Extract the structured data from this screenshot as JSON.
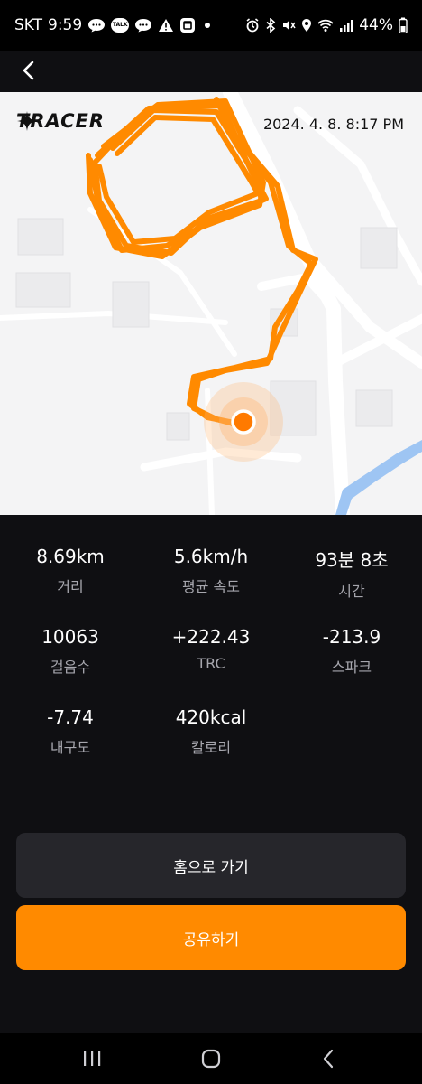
{
  "status_bar": {
    "carrier": "SKT",
    "time": "9:59",
    "talk_badge": "TALK",
    "battery": "44%"
  },
  "map": {
    "brand": "TRACER",
    "datetime": "2024. 4. 8. 8:17 PM",
    "route_color": "#FF8A00"
  },
  "stats": [
    {
      "value": "8.69km",
      "label": "거리"
    },
    {
      "value": "5.6km/h",
      "label": "평균 속도"
    },
    {
      "value": "93분 8초",
      "label": "시간"
    },
    {
      "value": "10063",
      "label": "걸음수"
    },
    {
      "value": "+222.43",
      "label": "TRC"
    },
    {
      "value": "-213.9",
      "label": "스파크"
    },
    {
      "value": "-7.74",
      "label": "내구도"
    },
    {
      "value": "420kcal",
      "label": "칼로리"
    }
  ],
  "buttons": {
    "home": "홈으로 가기",
    "share": "공유하기"
  },
  "colors": {
    "accent": "#FF8A00",
    "background": "#0F0F12",
    "secondary_button": "#26262B"
  }
}
